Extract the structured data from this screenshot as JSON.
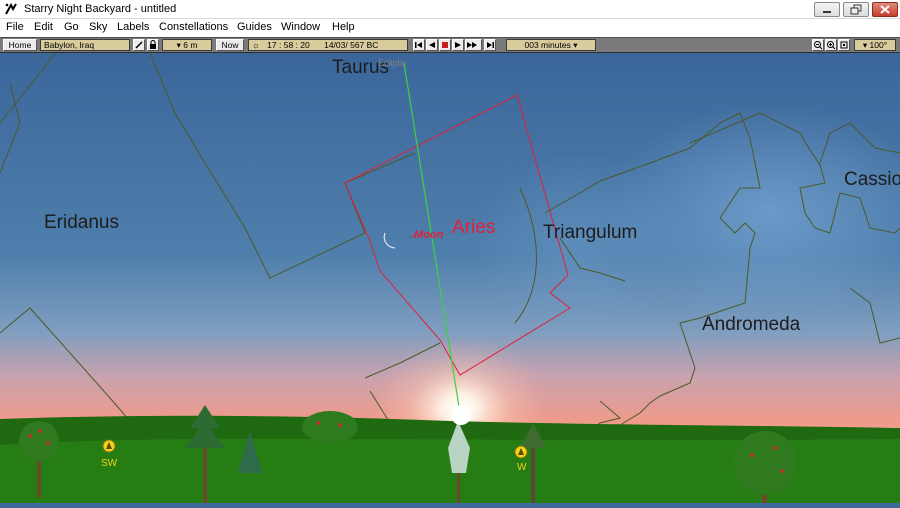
{
  "window": {
    "title": "Starry Night Backyard - untitled"
  },
  "menu": [
    "File",
    "Edit",
    "Go",
    "Sky",
    "Labels",
    "Constellations",
    "Guides",
    "Window",
    "Help"
  ],
  "toolbar": {
    "home_label": "Home",
    "location": "Babylon, Iraq",
    "elevation": "6 m",
    "now_label": "Now",
    "time": "17 : 58 : 20",
    "date": "14/03/  567 BC",
    "time_step": "003 minutes",
    "fov": "100°"
  },
  "sky": {
    "constellations": [
      "Taurus",
      "Eridanus",
      "Aries",
      "Triangulum",
      "Andromeda",
      "Cassio"
    ],
    "ecliptic_label": "Ecliptic",
    "moon_label": "Moon",
    "directions": [
      "SW",
      "W"
    ]
  },
  "colors": {
    "sky_top": "#3f6a9a",
    "horizon_glow": "#f0a08a",
    "ground": "#1f6a10",
    "selected_constellation": "#e0203a",
    "ecliptic": "#3cd23c"
  }
}
